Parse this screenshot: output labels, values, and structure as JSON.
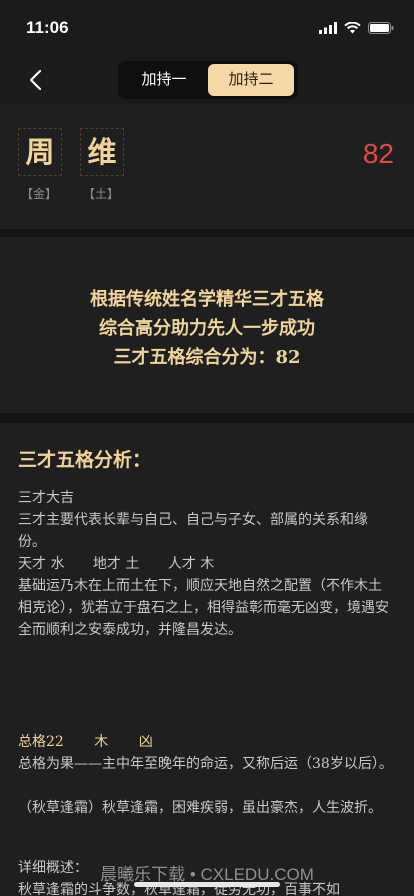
{
  "status": {
    "time": "11:06"
  },
  "tabs": [
    {
      "label": "加持一",
      "selected": false
    },
    {
      "label": "加持二",
      "selected": true
    }
  ],
  "name": {
    "chars": [
      {
        "char": "周",
        "element": "【金】"
      },
      {
        "char": "维",
        "element": "【土】"
      }
    ],
    "score": "82"
  },
  "summary": {
    "line1": "根据传统姓名学精华三才五格",
    "line2": "综合高分助力先人一步成功",
    "line3": "三才五格综合分为：82"
  },
  "analysis": {
    "title": "三才五格分析：",
    "sancai_result": "三才大吉",
    "sancai_desc": "三才主要代表长辈与自己、自己与子女、部属的关系和缘份。",
    "tian": "天才 水",
    "di": "地才 土",
    "ren": "人才 木",
    "sancai_detail": "基础运乃木在上而土在下，顺应天地自然之配置（不作木土相克论），犹若立于盘石之上，相得益彰而毫无凶变，境遇安全而顺利之安泰成功，并隆昌发达。",
    "zongge_label": "总格22",
    "zongge_element": "木",
    "zongge_luck": "凶",
    "zongge_desc": "总格为果——主中年至晚年的命运，又称后运（38岁以后）。",
    "zongge_poem": "（秋草逢霜）秋草逢霜，困难疾弱，虽出豪杰，人生波折。",
    "detail_label": "详细概述：",
    "detail_text": "秋草逢霜的斗争数，秋草逢霜，徒劳无功，百事不如"
  },
  "watermark": "晨曦乐下载 • CXLEDU.COM"
}
